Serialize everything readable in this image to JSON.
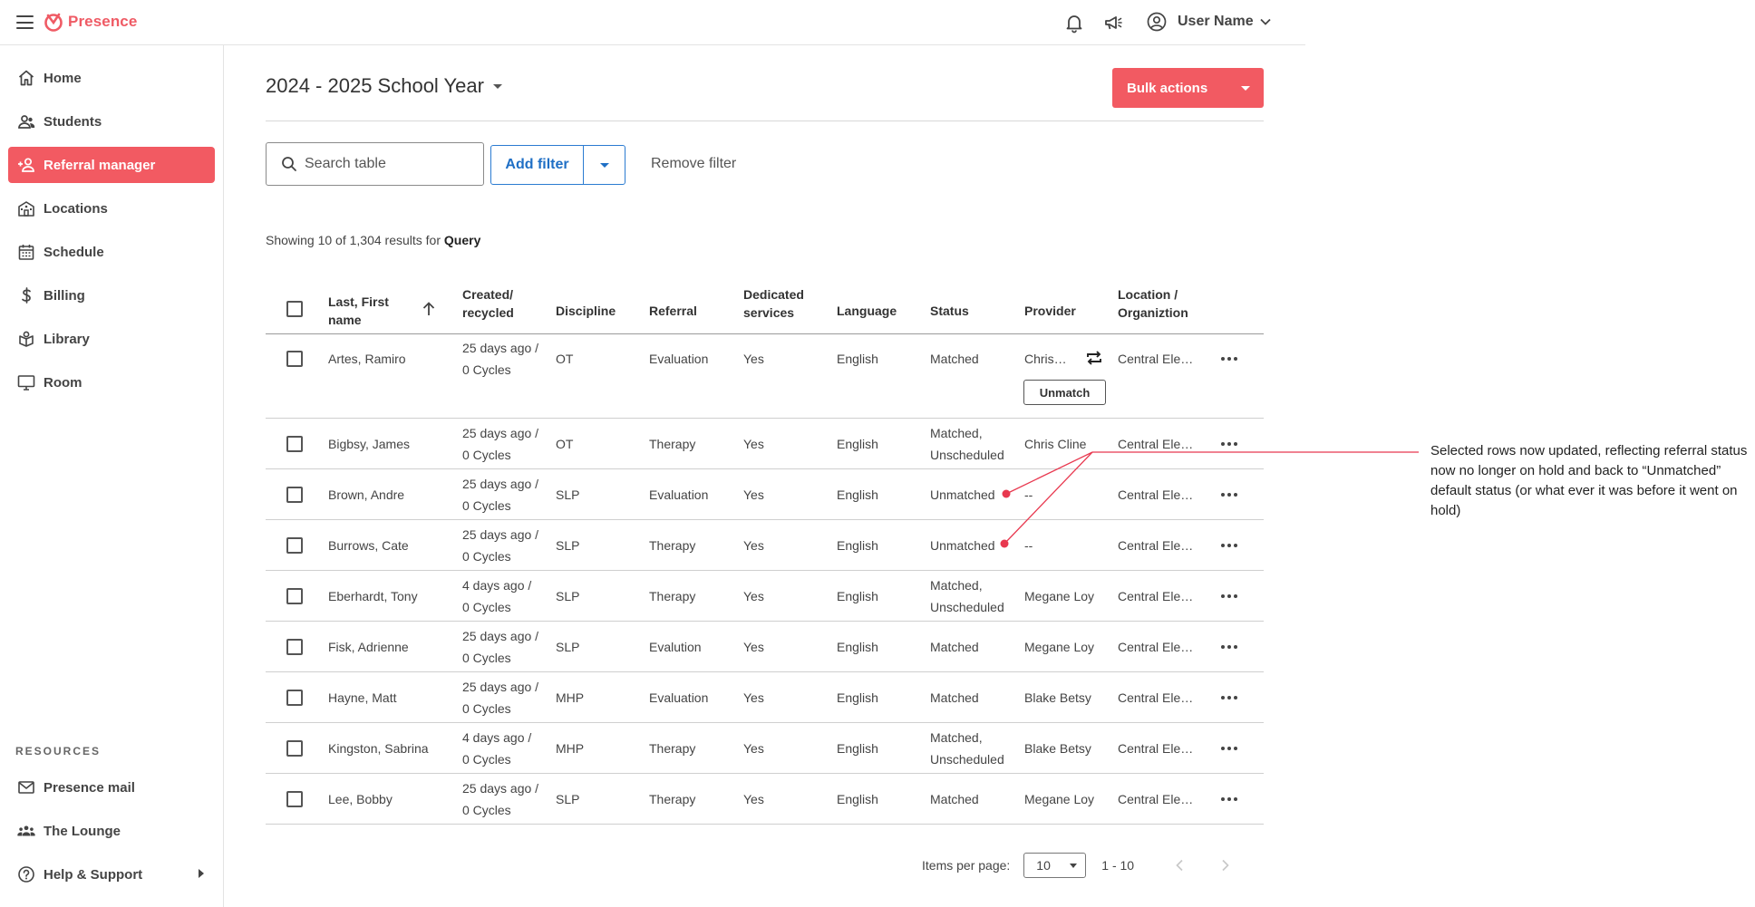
{
  "app": {
    "name": "Presence"
  },
  "topbar": {
    "user_name": "User Name"
  },
  "sidebar": {
    "items": [
      {
        "label": "Home"
      },
      {
        "label": "Students"
      },
      {
        "label": "Referral manager"
      },
      {
        "label": "Locations"
      },
      {
        "label": "Schedule"
      },
      {
        "label": "Billing"
      },
      {
        "label": "Library"
      },
      {
        "label": "Room"
      }
    ],
    "resources_title": "RESOURCES",
    "resources": [
      {
        "label": "Presence mail"
      },
      {
        "label": "The Lounge"
      },
      {
        "label": "Help & Support"
      }
    ]
  },
  "main": {
    "school_year": "2024 - 2025 School Year",
    "bulk_actions": "Bulk actions",
    "search_placeholder": "Search table",
    "add_filter": "Add filter",
    "remove_filter": "Remove filter",
    "showing_prefix": "Showing 10 of 1,304 results for",
    "showing_query": "Query"
  },
  "table": {
    "headers": {
      "name_1": "Last, First",
      "name_2": "name",
      "created_1": "Created/",
      "created_2": "recycled",
      "discipline": "Discipline",
      "referral": "Referral",
      "dedicated_1": "Dedicated",
      "dedicated_2": "services",
      "language": "Language",
      "status": "Status",
      "provider": "Provider",
      "location_1": "Location /",
      "location_2": "Organiztion"
    },
    "rows": [
      {
        "name": "Artes, Ramiro",
        "created_1": "25 days ago /",
        "created_2": "0 Cycles",
        "discipline": "OT",
        "referral": "Evaluation",
        "dedicated": "Yes",
        "language": "English",
        "status_1": "Matched",
        "status_2": "",
        "provider": "Chris…",
        "location": "Central Ele…",
        "unmatch": "Unmatch"
      },
      {
        "name": "Bigbsy, James",
        "created_1": "25 days ago /",
        "created_2": "0 Cycles",
        "discipline": "OT",
        "referral": "Therapy",
        "dedicated": "Yes",
        "language": "English",
        "status_1": "Matched,",
        "status_2": "Unscheduled",
        "provider": "Chris Cline",
        "location": "Central Ele…"
      },
      {
        "name": "Brown, Andre",
        "created_1": "25 days ago /",
        "created_2": "0 Cycles",
        "discipline": "SLP",
        "referral": "Evaluation",
        "dedicated": "Yes",
        "language": "English",
        "status_1": "Unmatched",
        "status_2": "",
        "provider": "--",
        "location": "Central Ele…"
      },
      {
        "name": "Burrows, Cate",
        "created_1": "25 days ago /",
        "created_2": "0 Cycles",
        "discipline": "SLP",
        "referral": "Therapy",
        "dedicated": "Yes",
        "language": "English",
        "status_1": "Unmatched",
        "status_2": "",
        "provider": "--",
        "location": "Central Ele…"
      },
      {
        "name": "Eberhardt, Tony",
        "created_1": "4 days ago /",
        "created_2": "0 Cycles",
        "discipline": "SLP",
        "referral": "Therapy",
        "dedicated": "Yes",
        "language": "English",
        "status_1": "Matched,",
        "status_2": "Unscheduled",
        "provider": "Megane Loy",
        "location": "Central Ele…"
      },
      {
        "name": "Fisk, Adrienne",
        "created_1": "25 days ago /",
        "created_2": "0 Cycles",
        "discipline": "SLP",
        "referral": "Evalution",
        "dedicated": "Yes",
        "language": "English",
        "status_1": "Matched",
        "status_2": "",
        "provider": "Megane Loy",
        "location": "Central Ele…"
      },
      {
        "name": "Hayne, Matt",
        "created_1": "25 days ago /",
        "created_2": "0 Cycles",
        "discipline": "MHP",
        "referral": "Evaluation",
        "dedicated": "Yes",
        "language": "English",
        "status_1": "Matched",
        "status_2": "",
        "provider": "Blake Betsy",
        "location": "Central Ele…"
      },
      {
        "name": "Kingston, Sabrina",
        "created_1": "4 days ago /",
        "created_2": "0 Cycles",
        "discipline": "MHP",
        "referral": "Therapy",
        "dedicated": "Yes",
        "language": "English",
        "status_1": "Matched,",
        "status_2": "Unscheduled",
        "provider": "Blake Betsy",
        "location": "Central Ele…"
      },
      {
        "name": "Lee, Bobby",
        "created_1": "25 days ago /",
        "created_2": "0 Cycles",
        "discipline": "SLP",
        "referral": "Therapy",
        "dedicated": "Yes",
        "language": "English",
        "status_1": "Matched",
        "status_2": "",
        "provider": "Megane Loy",
        "location": "Central Ele…"
      }
    ]
  },
  "pagination": {
    "items_label": "Items per page:",
    "per_page": "10",
    "range": "1 - 10"
  },
  "annotation": {
    "text": "Selected rows now updated, reflecting referral status now no longer on hold and back to “Unmatched” default status (or what ever it was before it went on hold)"
  },
  "colors": {
    "brand": "#f25a62",
    "link": "#1f6fc5",
    "annotation": "#e8384f"
  }
}
